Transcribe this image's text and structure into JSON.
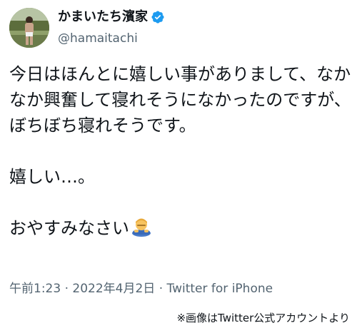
{
  "tweet": {
    "display_name": "かまいたち濱家",
    "handle": "@hamaitachi",
    "verified_icon": "verified-badge-icon",
    "verified_color": "#1d9bf0",
    "lines": {
      "p1": "今日はほんとに嬉しい事がありまして、なかなか興奮して寝れそうになかったのですが、ぼちぼち寝れそうです。",
      "p2": "嬉しい…。",
      "p3": "おやすみなさい"
    },
    "emoji": "bowing-man-emoji",
    "timestamp_time": "午前1:23",
    "separator": "·",
    "timestamp_date": "2022年4月2日",
    "source": "Twitter for iPhone"
  },
  "credit": "※画像はTwitter公式アカウントより"
}
